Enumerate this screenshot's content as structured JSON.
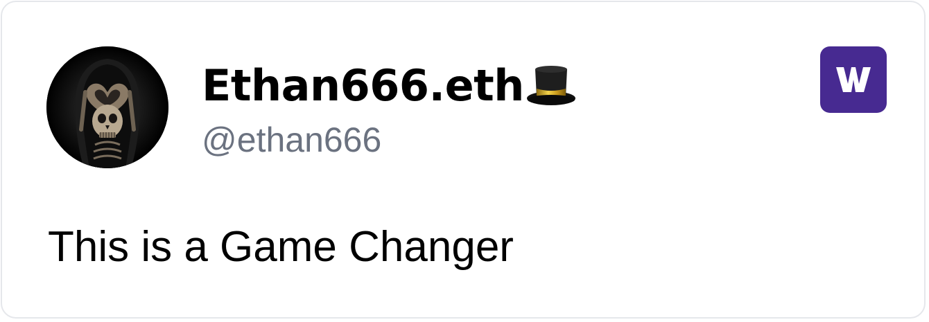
{
  "author": {
    "display_name": "Ethan666.eth",
    "name_emoji": "top-hat",
    "handle": "@ethan666",
    "avatar": "skull-reaper-heart-hands"
  },
  "post": {
    "text": "This is a Game Changer"
  },
  "brand": {
    "logo": "warpcast-w-icon",
    "color": "#472a91"
  },
  "colors": {
    "name": "#000000",
    "handle": "#6b7280",
    "border": "#e5e7eb"
  }
}
